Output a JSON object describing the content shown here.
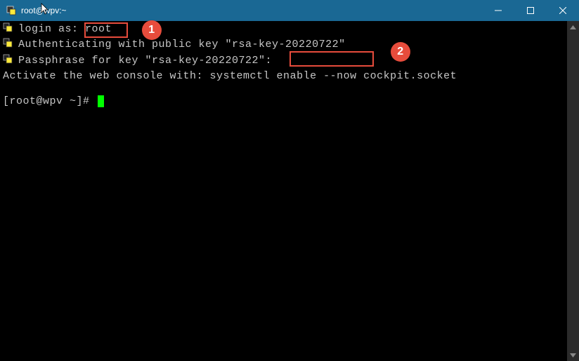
{
  "window": {
    "title": "root@wpv:~"
  },
  "terminal": {
    "line1_prefix": "login as: ",
    "line1_user": "root",
    "line2": "Authenticating with public key \"rsa-key-20220722\"",
    "line3": "Passphrase for key \"rsa-key-20220722\": ",
    "line4": "Activate the web console with: systemctl enable --now cockpit.socket",
    "prompt": "[root@wpv ~]# "
  },
  "callouts": {
    "c1": "1",
    "c2": "2"
  }
}
